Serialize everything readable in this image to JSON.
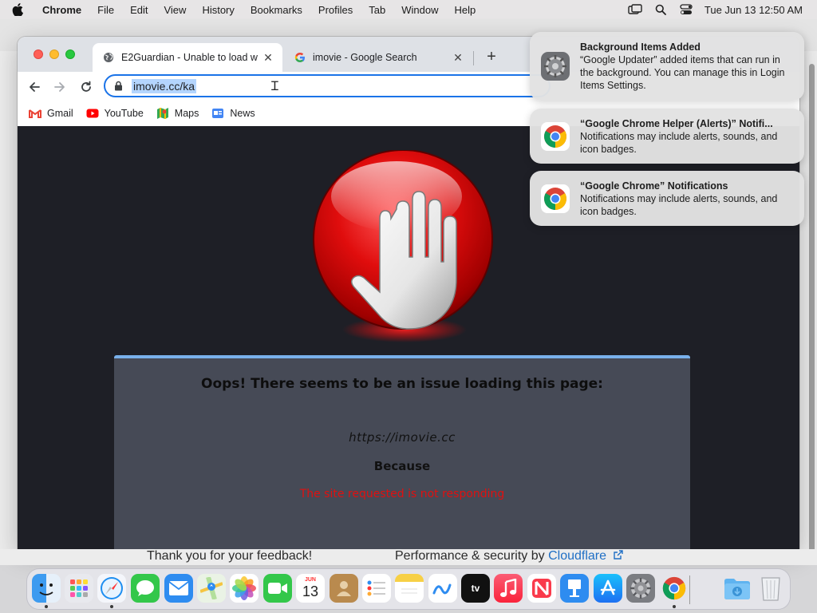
{
  "menubar": {
    "app_name": "Chrome",
    "items": [
      "File",
      "Edit",
      "View",
      "History",
      "Bookmarks",
      "Profiles",
      "Tab",
      "Window",
      "Help"
    ],
    "datetime": "Tue Jun 13  12:50 AM"
  },
  "browser": {
    "tabs": [
      {
        "title": "E2Guardian - Unable to load w",
        "favicon": "globe-icon",
        "active": true
      },
      {
        "title": "imovie - Google Search",
        "favicon": "google-icon",
        "active": false
      }
    ],
    "url": "imovie.cc/ka",
    "bookmarks": [
      {
        "label": "Gmail",
        "icon": "gmail-icon"
      },
      {
        "label": "YouTube",
        "icon": "youtube-icon"
      },
      {
        "label": "Maps",
        "icon": "maps-icon"
      },
      {
        "label": "News",
        "icon": "news-icon"
      }
    ]
  },
  "page": {
    "heading": "Oops! There seems to be an issue loading this page:",
    "site": "https://imovie.cc",
    "because": "Because",
    "reason": "The site requested is not responding",
    "reason_color": "#e01010",
    "panel_accent": "#79b0ea"
  },
  "below_content": {
    "feedback": "Thank you for your feedback!",
    "cloudflare_prefix": "Performance & security by ",
    "cloudflare_link": "Cloudflare"
  },
  "notifications": [
    {
      "title": "Background Items Added",
      "body": "“Google Updater” added items that can run in the background. You can manage this in Login Items Settings.",
      "icon": "system-settings-icon"
    },
    {
      "title": "“Google Chrome Helper (Alerts)” Notifi...",
      "body": "Notifications may include alerts, sounds, and icon badges.",
      "icon": "chrome-icon"
    },
    {
      "title": "“Google Chrome” Notifications",
      "body": "Notifications may include alerts, sounds, and icon badges.",
      "icon": "chrome-icon"
    }
  ],
  "dock": {
    "calendar_month": "JUN",
    "calendar_day": "13",
    "tv_label": "tv"
  }
}
